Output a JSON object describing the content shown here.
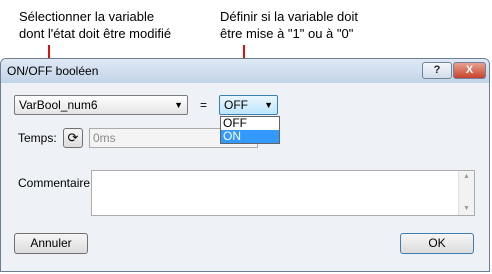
{
  "annotations": {
    "left": [
      "Sélectionner la variable",
      "dont l'état doit être modifié"
    ],
    "right": [
      "Définir si la variable doit",
      "être mise à \"1\" ou à \"0\""
    ]
  },
  "window": {
    "title": "ON/OFF booléen",
    "help_label": "?",
    "close_label": "X"
  },
  "form": {
    "variable_value": "VarBool_num6",
    "equals": "=",
    "state_value": "OFF",
    "state_options": [
      "OFF",
      "ON"
    ],
    "time_label": "Temps:",
    "time_value": "0ms",
    "comment_label": "Commentaire:",
    "comment_value": ""
  },
  "buttons": {
    "cancel": "Annuler",
    "ok": "OK"
  },
  "colors": {
    "arrow": "#e01010",
    "selection": "#3399ff"
  }
}
